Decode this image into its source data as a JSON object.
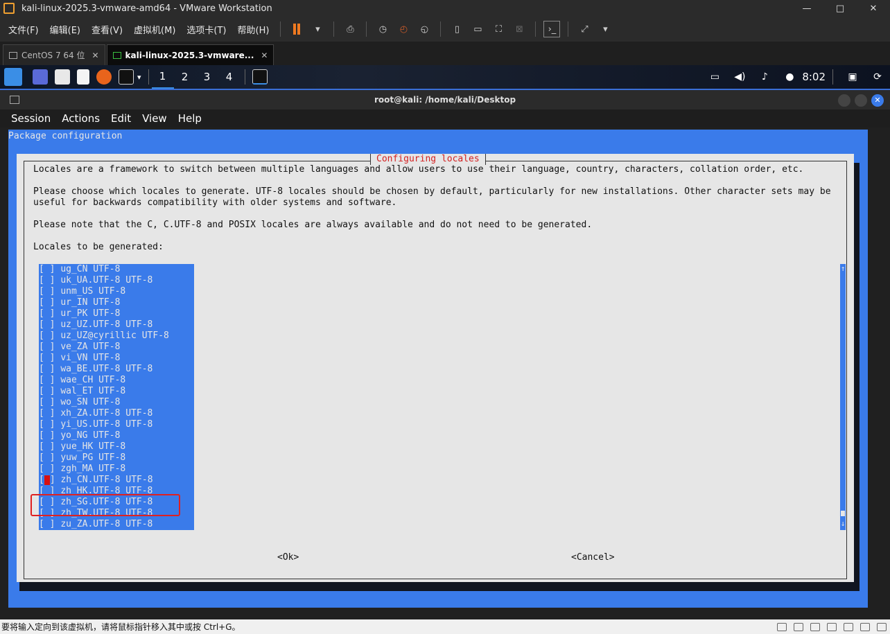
{
  "window": {
    "title": "kali-linux-2025.3-vmware-amd64 - VMware Workstation",
    "minimize": "—",
    "maximize": "□",
    "close": "✕"
  },
  "menubar": {
    "items": [
      "文件(F)",
      "编辑(E)",
      "查看(V)",
      "虚拟机(M)",
      "选项卡(T)",
      "帮助(H)"
    ]
  },
  "tabs": [
    {
      "label": "CentOS 7 64 位",
      "close": "✕"
    },
    {
      "label": "kali-linux-2025.3-vmware...",
      "close": "✕"
    }
  ],
  "kali_panel": {
    "workspaces": [
      "1",
      "2",
      "3",
      "4"
    ],
    "clock": "8:02"
  },
  "terminal": {
    "title": "root@kali: /home/kali/Desktop",
    "menu": [
      "Session",
      "Actions",
      "Edit",
      "View",
      "Help"
    ]
  },
  "dialog": {
    "package_title": "Package configuration",
    "title": "Configuring locales",
    "para1": "Locales are a framework to switch between multiple languages and allow users to use their language, country, characters, collation order, etc.",
    "para2_line1": "Please choose which locales to generate. UTF-8 locales should be chosen by default, particularly for new installations. Other character sets may be",
    "para2_line2": "useful for backwards compatibility with older systems and software.",
    "para3": "Please note that the C, C.UTF-8 and POSIX locales are always available and do not need to be generated.",
    "list_label": "Locales to be generated:",
    "locales": [
      "ug_CN UTF-8",
      "uk_UA.UTF-8 UTF-8",
      "unm_US UTF-8",
      "ur_IN UTF-8",
      "ur_PK UTF-8",
      "uz_UZ.UTF-8 UTF-8",
      "uz_UZ@cyrillic UTF-8",
      "ve_ZA UTF-8",
      "vi_VN UTF-8",
      "wa_BE.UTF-8 UTF-8",
      "wae_CH UTF-8",
      "wal_ET UTF-8",
      "wo_SN UTF-8",
      "xh_ZA.UTF-8 UTF-8",
      "yi_US.UTF-8 UTF-8",
      "yo_NG UTF-8",
      "yue_HK UTF-8",
      "yuw_PG UTF-8",
      "zgh_MA UTF-8",
      "zh_CN.UTF-8 UTF-8",
      "zh_HK.UTF-8 UTF-8",
      "zh_SG.UTF-8 UTF-8",
      "zh_TW.UTF-8 UTF-8",
      "zu_ZA.UTF-8 UTF-8"
    ],
    "checkbox_empty": "[ ] ",
    "cursor_row": 19,
    "scroll_up": "↑",
    "scroll_down": "↓",
    "ok": "<Ok>",
    "cancel": "<Cancel>"
  },
  "statusbar": {
    "text": "要将输入定向到该虚拟机，请将鼠标指针移入其中或按 Ctrl+G。"
  },
  "colors": {
    "dialog_bg": "#e6e6e6",
    "blue_bg": "#3a7bea",
    "title_red": "#d42020",
    "highlight_box": "#e02020"
  }
}
